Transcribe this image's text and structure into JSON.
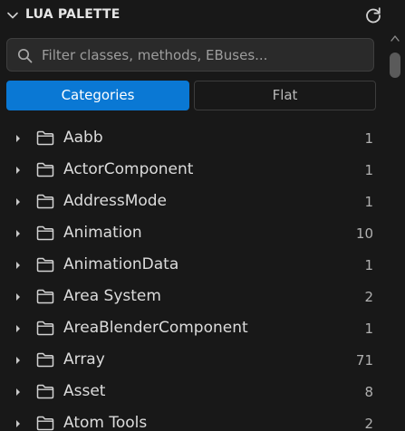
{
  "header": {
    "title": "LUA PALETTE",
    "collapse_icon": "chevron-down-icon",
    "refresh_icon": "refresh-icon"
  },
  "search": {
    "placeholder": "Filter classes, methods, EBuses...",
    "value": "",
    "icon": "search-icon"
  },
  "view_toggle": {
    "categories_label": "Categories",
    "flat_label": "Flat",
    "selected": "Categories"
  },
  "colors": {
    "background": "#181818",
    "accent": "#0a78d4",
    "text": "#dcdcdc",
    "count_text": "#b0b0b0",
    "search_bg": "#2a2a2a"
  },
  "categories": [
    {
      "name": "Aabb",
      "count": "1"
    },
    {
      "name": "ActorComponent",
      "count": "1"
    },
    {
      "name": "AddressMode",
      "count": "1"
    },
    {
      "name": "Animation",
      "count": "10"
    },
    {
      "name": "AnimationData",
      "count": "1"
    },
    {
      "name": "Area System",
      "count": "2"
    },
    {
      "name": "AreaBlenderComponent",
      "count": "1"
    },
    {
      "name": "Array",
      "count": "71"
    },
    {
      "name": "Asset",
      "count": "8"
    },
    {
      "name": "Atom Tools",
      "count": "2"
    }
  ]
}
